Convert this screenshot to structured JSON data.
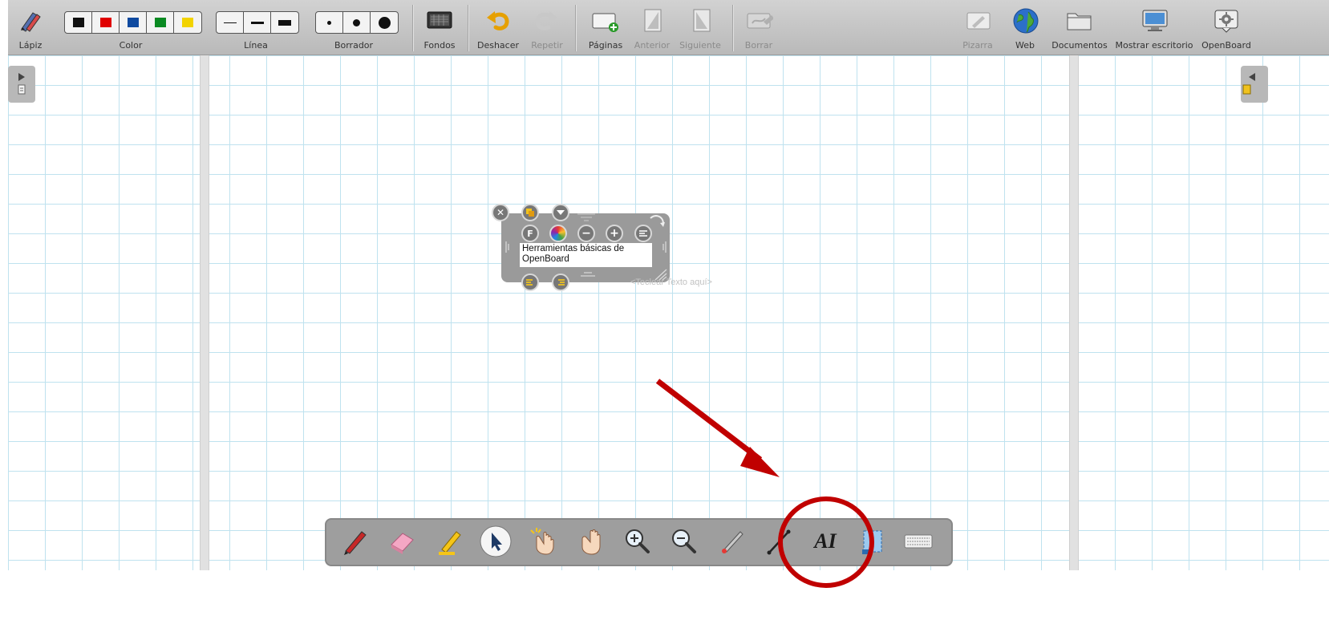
{
  "toolbar": {
    "pencil": {
      "label": "Lápiz",
      "icon": "pencil-icon"
    },
    "color": {
      "label": "Color",
      "swatches": [
        "#111111",
        "#e00000",
        "#0f4aa0",
        "#0a8a22",
        "#f2d300"
      ]
    },
    "line": {
      "label": "Línea",
      "widths": [
        "thin",
        "medium",
        "thick"
      ]
    },
    "eraser": {
      "label": "Borrador",
      "sizes": [
        "small",
        "medium",
        "large"
      ]
    },
    "backgrounds": {
      "label": "Fondos",
      "icon": "background-icon"
    },
    "undo": {
      "label": "Deshacer",
      "icon": "undo-icon"
    },
    "redo": {
      "label": "Repetir",
      "icon": "redo-icon"
    },
    "pages": {
      "label": "Páginas",
      "icon": "add-page-icon"
    },
    "previous": {
      "label": "Anterior",
      "icon": "previous-page-icon"
    },
    "next": {
      "label": "Siguiente",
      "icon": "next-page-icon"
    },
    "erase": {
      "label": "Borrar",
      "icon": "clear-page-icon"
    },
    "board": {
      "label": "Pizarra",
      "icon": "board-icon"
    },
    "web": {
      "label": "Web",
      "icon": "globe-icon"
    },
    "documents": {
      "label": "Documentos",
      "icon": "folder-icon"
    },
    "show_desktop": {
      "label": "Mostrar escritorio",
      "icon": "desktop-icon"
    },
    "openboard": {
      "label": "OpenBoard",
      "icon": "settings-icon"
    }
  },
  "text_widget": {
    "content": "Herramientas básicas de OpenBoard",
    "placeholder": "<Teclear Texto aquí>",
    "buttons": [
      "close-icon",
      "duplicate-icon",
      "menu-icon",
      "font-icon",
      "color-icon",
      "decrease-size-icon",
      "increase-size-icon",
      "align-icon"
    ]
  },
  "bottom_toolbar": {
    "tools": [
      "pen-icon",
      "eraser-icon",
      "highlighter-icon",
      "selector-icon",
      "interact-icon",
      "hand-icon",
      "zoom-in-icon",
      "zoom-out-icon",
      "laser-pointer-icon",
      "line-icon",
      "text-icon",
      "capture-icon",
      "virtual-keyboard-icon"
    ],
    "active": "selector-icon",
    "text_tool_glyph": "AI"
  },
  "colors": {
    "annotation_red": "#c00000",
    "grid": "#bfe2ef"
  }
}
